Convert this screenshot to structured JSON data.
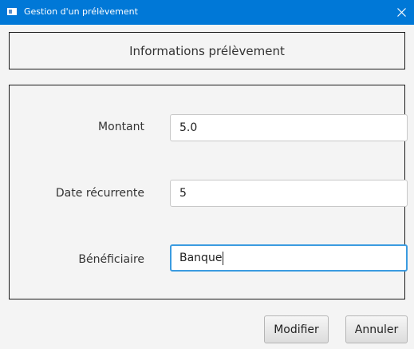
{
  "window": {
    "title": "Gestion d'un prélèvement",
    "app_icon": "window-app-icon",
    "close_icon": "close-icon"
  },
  "header": {
    "title": "Informations prélèvement"
  },
  "form": {
    "montant": {
      "label": "Montant",
      "value": "5.0"
    },
    "date": {
      "label": "Date récurrente",
      "value": "5"
    },
    "beneficiaire": {
      "label": "Bénéficiaire",
      "value": "Banque"
    }
  },
  "buttons": {
    "modifier": "Modifier",
    "annuler": "Annuler"
  },
  "colors": {
    "titlebar": "#0078d7",
    "focus": "#3b9be0"
  }
}
